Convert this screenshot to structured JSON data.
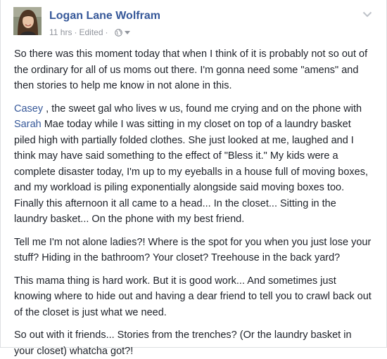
{
  "post": {
    "author": "Logan Lane Wolfram",
    "time": "11 hrs",
    "separator": "·",
    "edited": "Edited",
    "separator2": "·",
    "privacy_icon": "globe-icon",
    "audience_icon": "caret-down-icon",
    "options_icon": "chevron-down-icon",
    "link_color": "#365899",
    "text_color": "#1d2129",
    "paragraphs": [
      {
        "text": "So there was this moment today that when I think of it is probably not so out of the ordinary for all of us moms out there. I'm gonna need some \"amens\" and then stories to help me know in not alone in this."
      },
      {
        "mention1": "Casey",
        "text1": " , the sweet gal who lives w us, found me crying and on the phone with ",
        "mention2": "Sarah",
        "text2": " Mae today while I was sitting in my closet on top of a laundry basket piled high with partially folded clothes. She just looked at me, laughed and I think may have said something to the effect of \"Bless it.\" My kids were a complete disaster today, I'm up to my eyeballs in a house full of moving boxes, and my workload is piling exponentially alongside said moving boxes too. Finally this afternoon it all came to a head... In the closet... Sitting in the laundry basket... On the phone with my best friend."
      },
      {
        "text": "Tell me I'm not alone ladies?! Where is the spot for you when you just lose your stuff? Hiding in the bathroom? Your closet? Treehouse in the back yard?"
      },
      {
        "text": "This mama thing is hard work. But it is good work... And sometimes just knowing where to hide out and having a dear friend to tell you to crawl back out of the closet is just what we need."
      },
      {
        "text": "So out with it friends... Stories from the trenches? (Or the laundry basket in your closet) whatcha got?!"
      }
    ]
  }
}
